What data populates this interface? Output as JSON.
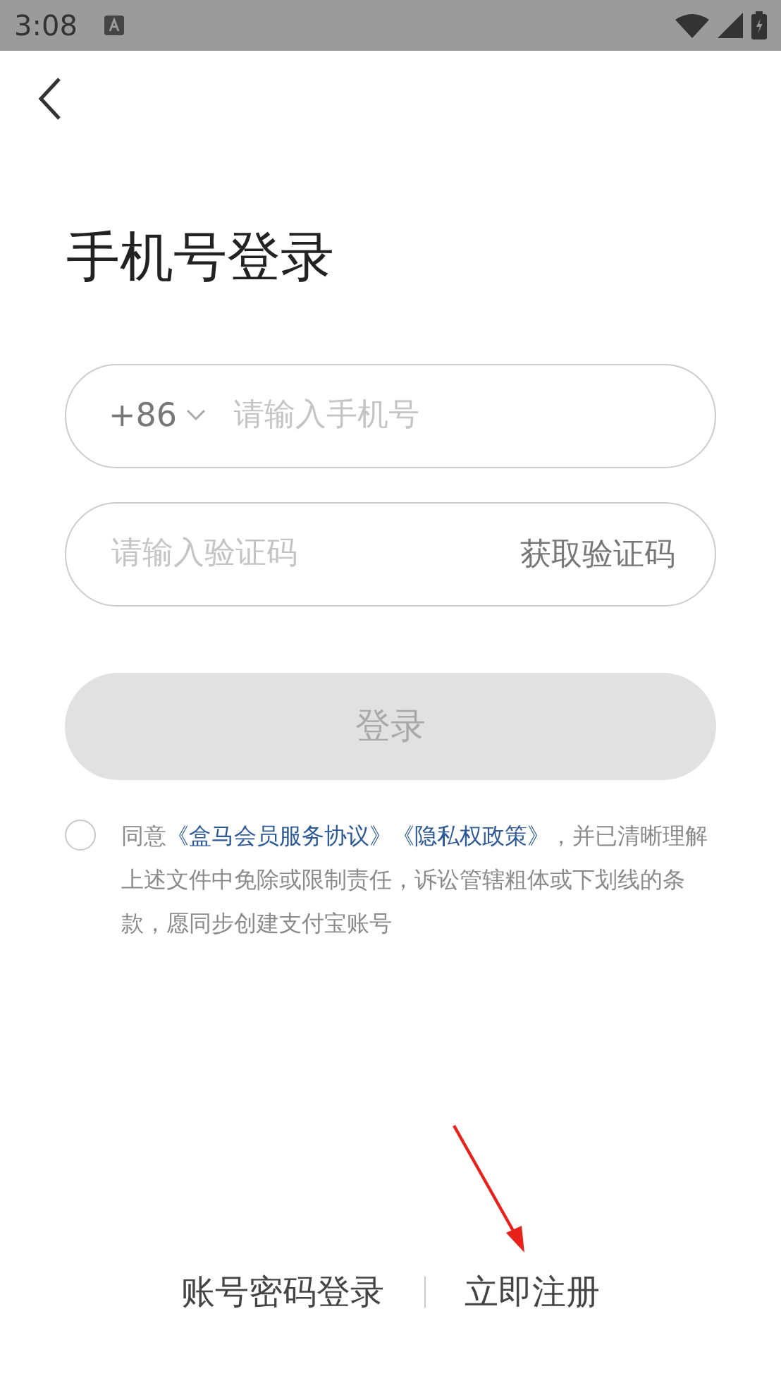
{
  "status_bar": {
    "time": "3:08"
  },
  "title": "手机号登录",
  "phone_field": {
    "country_code": "+86",
    "placeholder": "请输入手机号"
  },
  "code_field": {
    "placeholder": "请输入验证码",
    "action": "获取验证码"
  },
  "login_button": {
    "label": "登录",
    "disabled": true
  },
  "agreement": {
    "checked": false,
    "parts": [
      {
        "kind": "plain",
        "text": "同意"
      },
      {
        "kind": "link",
        "text": "《盒马会员服务协议》"
      },
      {
        "kind": "link",
        "text": "《隐私权政策》"
      },
      {
        "kind": "plain",
        "text": "，并已清晰理解上述文件中免除或限制责任，诉讼管辖粗体或下划线的条款，愿同步创建支付宝账号"
      }
    ]
  },
  "footer_links": [
    "账号密码登录",
    "立即注册"
  ]
}
